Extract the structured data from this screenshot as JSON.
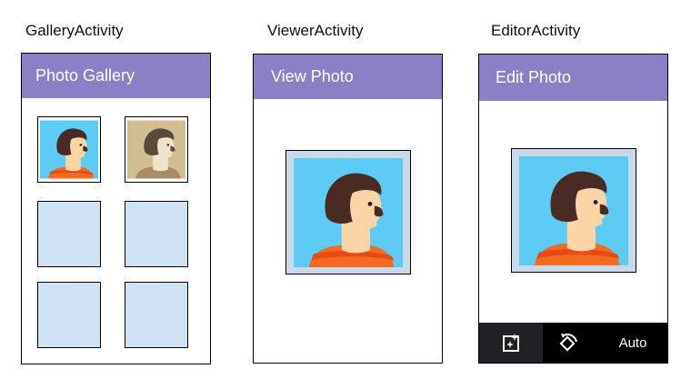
{
  "captions": {
    "gallery": "GalleryActivity",
    "viewer": "ViewerActivity",
    "editor": "EditorActivity"
  },
  "gallery": {
    "title": "Photo Gallery",
    "thumbnails": [
      "portrait-photo",
      "portrait-photo-sepia",
      "empty",
      "empty",
      "empty",
      "empty"
    ]
  },
  "viewer": {
    "title": "View Photo"
  },
  "editor": {
    "title": "Edit Photo",
    "toolbar": {
      "tools": [
        "auto-enhance-icon",
        "rotate-icon"
      ],
      "auto_label": "Auto"
    }
  },
  "colors": {
    "appbar": "#8c7fc6",
    "placeholder": "#cfe2f3",
    "photo_bg": "#5ecbf4",
    "toolbar": "#000000"
  }
}
